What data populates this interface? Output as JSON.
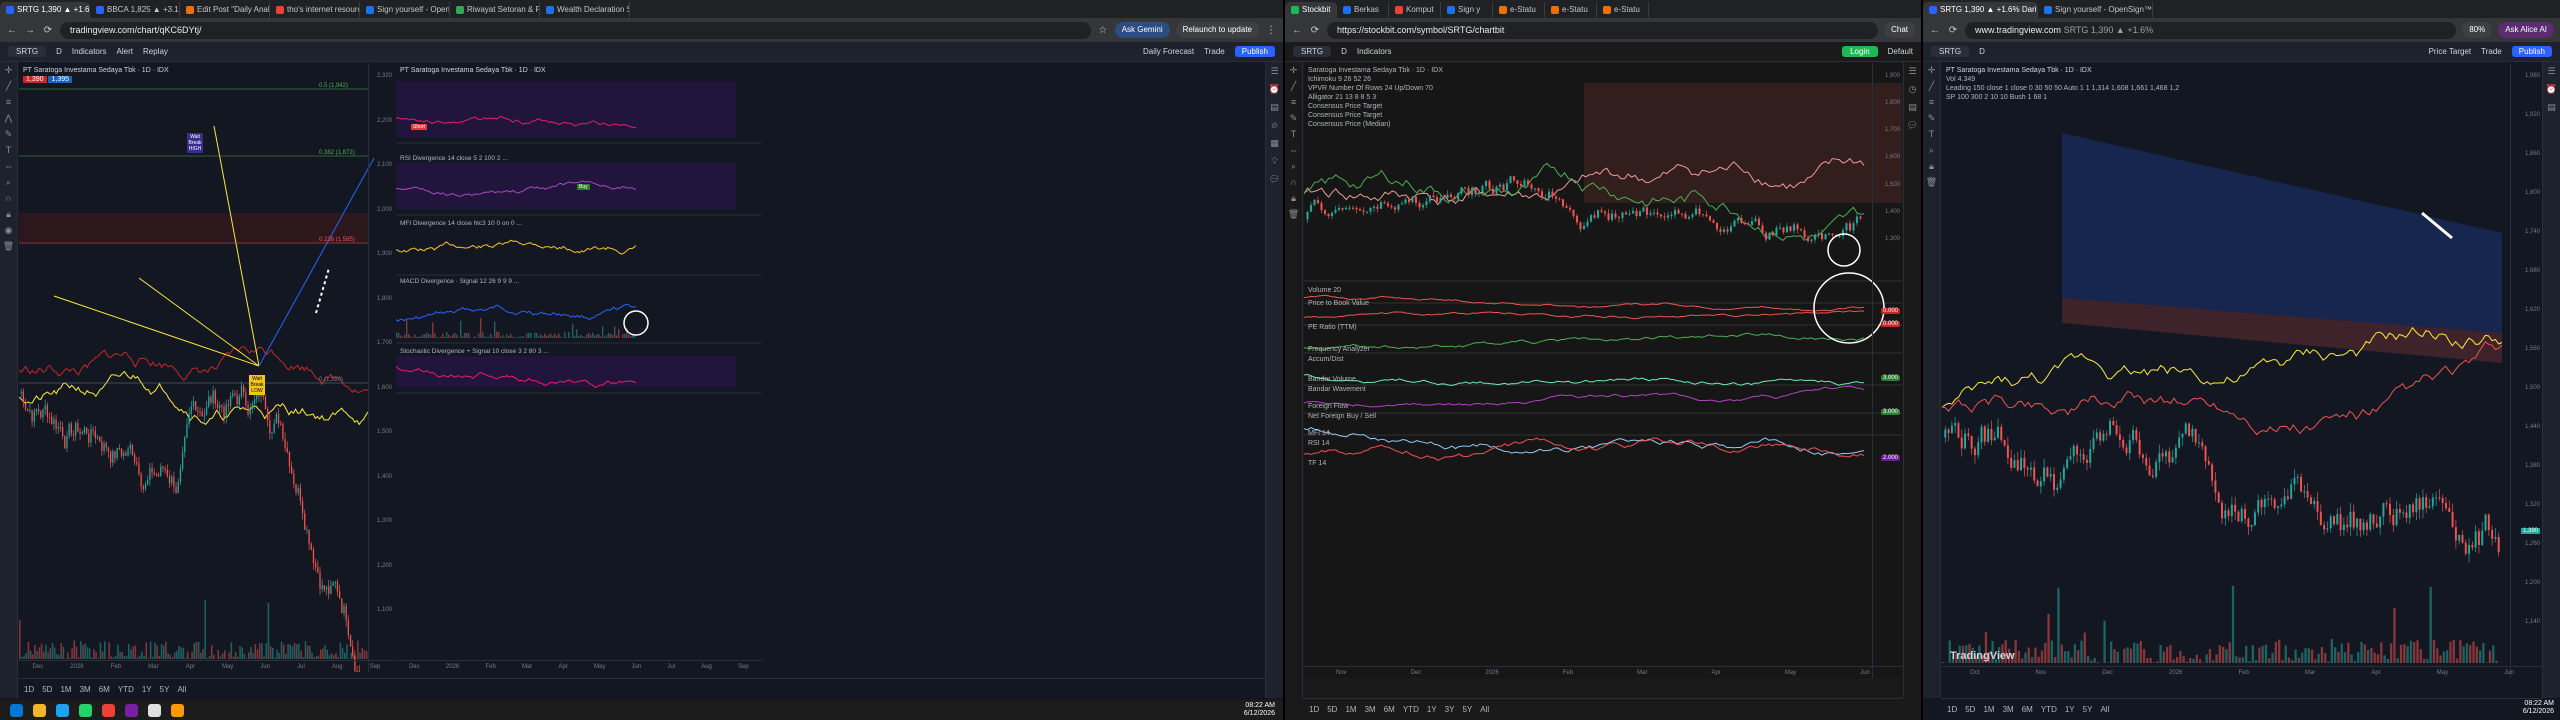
{
  "screen1": {
    "tabs": [
      {
        "label": "SRTG 1,390 ▲ +1.6% Dari",
        "color": "#2962ff",
        "active": true
      },
      {
        "label": "BBCA 1,825 ▲ +3.1% Supe",
        "color": "#2962ff"
      },
      {
        "label": "Edit Post \"Daily Analysis 20",
        "color": "#e8710a"
      },
      {
        "label": "tho's internet resources -",
        "color": "#ea4335"
      },
      {
        "label": "Sign yourself - OpenSign™",
        "color": "#1a73e8"
      },
      {
        "label": "Riwayat Setoran & Penarik",
        "color": "#34a853"
      },
      {
        "label": "Wealth Declaration Spage",
        "color": "#1a73e8"
      }
    ],
    "url": "tradingview.com/chart/qKC6DYtj/",
    "ask_gemini": "Ask Gemini",
    "relaunch": "Relaunch to update",
    "toolbar": {
      "symbol": "SRTG",
      "interval": "D",
      "indicators": "Indicators",
      "alert": "Alert",
      "replay": "Replay",
      "daily_forecast": "Daily Forecast",
      "trade": "Trade",
      "publish": "Publish"
    },
    "main_chart": {
      "legend_title": "PT Saratoga Investama Sedaya Tbk · 1D · IDX",
      "price_sell": "1,390",
      "price_buy": "1,395",
      "price_ticks": [
        "2,320",
        "2,200",
        "2,100",
        "2,000",
        "1,900",
        "1,800",
        "1,700",
        "1,600",
        "1,500",
        "1,400",
        "1,300",
        "1,200",
        "1,100"
      ],
      "time_ticks": [
        "Dec",
        "2026",
        "Feb",
        "Mar",
        "Apr",
        "May",
        "Jun",
        "Jul",
        "Aug",
        "Sep"
      ],
      "fib_labels": [
        "0.5 (1,942)",
        "0.382 (1,872)",
        "0.236 (1,585)",
        "0 (1,280)"
      ],
      "callout_top": "Wait Break HIGH",
      "callout_bottom": "Wait Break LOW"
    },
    "right_chart": {
      "legend_title": "PT Saratoga Investama Sedaya Tbk · 1D · IDX",
      "rsi_label": "RSI Divergence 14 close 5 2 100 2 ...",
      "mfi_label": "MFI Divergence 14 close hlc3 10 0 on 0 ...",
      "macd_label": "MACD Divergence · Signal 12 26 9 9 9 ...",
      "stoch_label": "Stochastic Divergence + Signal 10 close 3 2 80 3 ...",
      "rsi_ticks": [
        "80",
        "60",
        "40",
        "20"
      ],
      "stoch_ticks": [
        "75.00",
        "50.00",
        "25.00",
        "0.00"
      ],
      "time_ticks": [
        "Dec",
        "2026",
        "Feb",
        "Mar",
        "Apr",
        "May",
        "Jun",
        "Jul",
        "Aug",
        "Sep"
      ],
      "buy_tag": "Buy",
      "sell_tag": "Short"
    },
    "timeframes": [
      "1D",
      "5D",
      "1M",
      "3M",
      "6M",
      "YTD",
      "1Y",
      "5Y",
      "All"
    ],
    "taskbar_time": "08:22 AM",
    "taskbar_date": "6/12/2026"
  },
  "screen2": {
    "tabs": [
      {
        "label": "Stockbit",
        "color": "#1db954",
        "active": true
      },
      {
        "label": "Berkas",
        "color": "#1a73e8"
      },
      {
        "label": "Komput",
        "color": "#ea4335"
      },
      {
        "label": "Sign y",
        "color": "#1a73e8"
      },
      {
        "label": "e-Statu",
        "color": "#e8710a"
      },
      {
        "label": "e-Statu",
        "color": "#e8710a"
      },
      {
        "label": "e-Statu",
        "color": "#e8710a"
      }
    ],
    "url": "https://stockbit.com/symbol/SRTG/chartbit",
    "chat": "Chat",
    "symbol": "SRTG",
    "interval": "D",
    "indicators": "Indicators",
    "login": "Login",
    "default": "Default",
    "legend_lines": [
      "Saratoga Investama Sedaya Tbk · 1D · IDX",
      "Ichimoku 9 26 52 26",
      "VPVR Number Of Rows 24 Up/Down 70",
      "Alligator 21 13 8 8 5 3",
      "Consensus Price Target",
      "Consensus Price Target",
      "Consensus Price (Median)"
    ],
    "price_ticks": [
      "1,900",
      "1,800",
      "1,700",
      "1,600",
      "1,500",
      "1,400",
      "1,300"
    ],
    "pane_labels": [
      "Volume 20",
      "Price to Book Value",
      "PE Ratio (TTM)",
      "Frequency Analyzer",
      "Accum/Dist",
      "Bandar Volume",
      "Bandar Wavement",
      "Foreign Flow",
      "Net Foreign Buy / Sell",
      "MFI 14",
      "RSI 14",
      "TF 14"
    ],
    "time_ticks": [
      "Nov",
      "Dec",
      "2026",
      "Feb",
      "Mar",
      "Apr",
      "May",
      "Jun"
    ],
    "timeframes": [
      "1D",
      "5D",
      "1M",
      "3M",
      "6M",
      "YTD",
      "1Y",
      "3Y",
      "5Y",
      "All"
    ],
    "footer_time": "08:22:13 (UTC+7)",
    "log": "log",
    "auto": "auto",
    "value_badges": [
      "0.000",
      "0.000",
      "3.000",
      "3.000",
      "2.000"
    ]
  },
  "screen3": {
    "tabs": [
      {
        "label": "SRTG 1,390 ▲ +1.6% Dari",
        "color": "#2962ff",
        "active": true
      },
      {
        "label": "Sign yourself - OpenSign™",
        "color": "#1a73e8"
      }
    ],
    "url": "www.tradingview.com",
    "url_title": "SRTG 1,390 ▲ +1.6%",
    "zoom": "80%",
    "ask_ai": "Ask Alice AI",
    "symbol": "SRTG",
    "interval": "D",
    "price_target": "Price Target",
    "trade": "Trade",
    "publish": "Publish",
    "legend_title": "PT Saratoga Investama Sedaya Tbk · 1D · IDX",
    "legend_line2": "Vol  4.349",
    "legend_line3": "Leading 150 close 1 close 0 30 50 50 Auto 1 1  1,314  1,608  1,661  1,468  1,2",
    "legend_line4": "SP 100 300 2 10 10 Bush 1 68 1",
    "price_ticks": [
      "1,980",
      "1,920",
      "1,860",
      "1,800",
      "1,740",
      "1,680",
      "1,620",
      "1,560",
      "1,500",
      "1,440",
      "1,380",
      "1,320",
      "1,260",
      "1,200",
      "1,140"
    ],
    "time_ticks": [
      "Oct",
      "Nov",
      "Dec",
      "2026",
      "Feb",
      "Mar",
      "Apr",
      "May",
      "Jun"
    ],
    "timeframes": [
      "1D",
      "5D",
      "1M",
      "3M",
      "6M",
      "YTD",
      "1Y",
      "5Y",
      "All"
    ],
    "footer_time": "08:22:13 UTC+7",
    "brand": "TradingView",
    "last_price": "1,390",
    "taskbar_time": "08:22 AM",
    "taskbar_date": "6/12/2026"
  }
}
